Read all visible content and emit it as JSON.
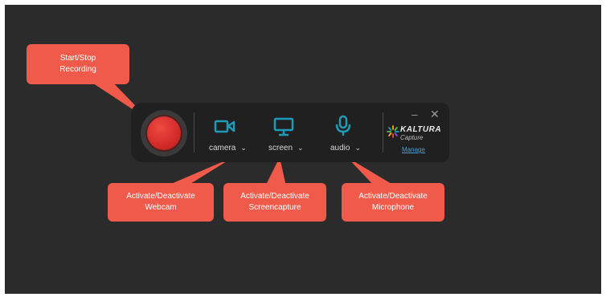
{
  "toolbar": {
    "sources": [
      {
        "label": "camera",
        "icon": "camera-icon"
      },
      {
        "label": "screen",
        "icon": "monitor-icon"
      },
      {
        "label": "audio",
        "icon": "microphone-icon"
      }
    ],
    "chevron": "⌄",
    "minimize": "–",
    "close": "✕",
    "brand": {
      "name": "KALTURA",
      "sub": "Capture",
      "manage": "Manage"
    }
  },
  "callouts": {
    "record": [
      "Start/Stop",
      "Recording"
    ],
    "webcam": [
      "Activate/Deactivate",
      "Webcam"
    ],
    "screen": [
      "Activate/Deactivate",
      "Screencapture"
    ],
    "mic": [
      "Activate/Deactivate",
      "Microphone"
    ]
  },
  "colors": {
    "background": "#2b2b2b",
    "toolbar": "#202020",
    "record": "#d42b28",
    "icon_teal": "#1e9bb8",
    "callout": "#f05a4a",
    "link": "#4a9fd6"
  }
}
